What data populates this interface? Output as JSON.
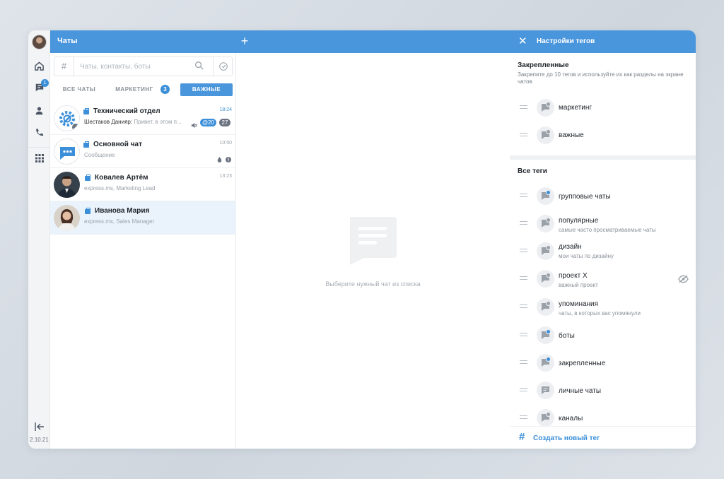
{
  "rail": {
    "unread_count": "1",
    "version": "2.10.21"
  },
  "chats": {
    "title": "Чаты",
    "add_label": "+",
    "search_placeholder": "Чаты, контакты, боты",
    "tabs": [
      {
        "label": "ВСЕ ЧАТЫ"
      },
      {
        "label": "МАРКЕТИНГ",
        "badge": "3"
      },
      {
        "label": "ВАЖНЫЕ"
      }
    ],
    "items": [
      {
        "name": "Технический отдел",
        "time": "18:24",
        "sender": "Шестаков Данияр:",
        "preview": "Привет, в этом п...",
        "mention": "@20",
        "count": "27"
      },
      {
        "name": "Основной чат",
        "time": "10:50",
        "preview": "Сообщение"
      },
      {
        "name": "Ковалев Артём",
        "time": "13:23",
        "preview": "express.ms, Marketing Lead"
      },
      {
        "name": "Иванова Мария",
        "time": "",
        "preview": "express.ms, Sales Manager"
      }
    ]
  },
  "center": {
    "placeholder": "Выберите нужный чат из списка"
  },
  "tag_settings": {
    "title": "Настройки тегов",
    "pinned_title": "Закрепленные",
    "pinned_desc": "Закрепите до 10 тегов и используйте их как разделы на экране чатов",
    "pinned": [
      {
        "name": "маркетинг"
      },
      {
        "name": "важные"
      }
    ],
    "all_title": "Все теги",
    "all": [
      {
        "name": "групповые чаты",
        "desc": ""
      },
      {
        "name": "популярные",
        "desc": "самые часто просматриваемые чаты"
      },
      {
        "name": "дизайн",
        "desc": "мои чаты по дизайну"
      },
      {
        "name": "проект X",
        "desc": "важный проект"
      },
      {
        "name": "упоминания",
        "desc": "чаты, в которых вас упомянули"
      },
      {
        "name": "боты",
        "desc": ""
      },
      {
        "name": "закрепленные",
        "desc": ""
      },
      {
        "name": "личные чаты",
        "desc": ""
      },
      {
        "name": "каналы",
        "desc": ""
      }
    ],
    "create_label": "Создать новый тег"
  },
  "colors": {
    "accent": "#4a96dc",
    "badge": "#3b8fd9",
    "selected_row": "#eaf3fc"
  }
}
